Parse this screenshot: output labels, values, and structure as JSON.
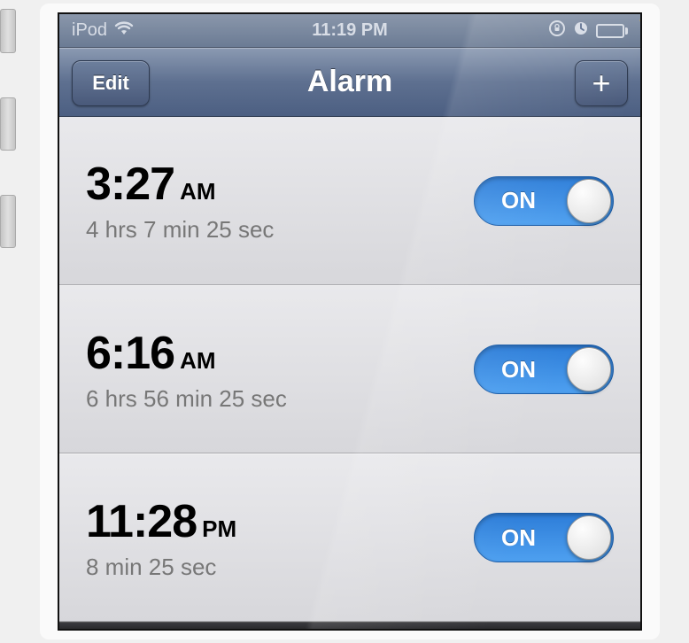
{
  "status": {
    "device_label": "iPod",
    "time": "11:19 PM"
  },
  "nav": {
    "title": "Alarm",
    "edit_label": "Edit",
    "add_label": "+"
  },
  "toggle": {
    "on_label": "ON"
  },
  "alarms": [
    {
      "time": "3:27",
      "period": "AM",
      "countdown": "4 hrs 7 min 25 sec",
      "on": true
    },
    {
      "time": "6:16",
      "period": "AM",
      "countdown": "6 hrs 56 min 25 sec",
      "on": true
    },
    {
      "time": "11:28",
      "period": "PM",
      "countdown": "8 min 25 sec",
      "on": true
    }
  ]
}
